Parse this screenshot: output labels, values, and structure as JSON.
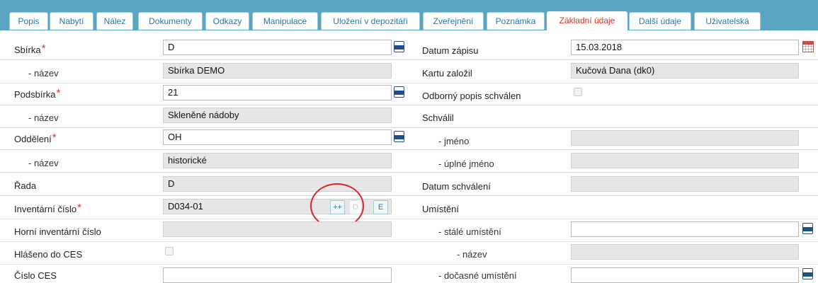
{
  "tabs": [
    {
      "label": "Popis"
    },
    {
      "label": "Nabytí"
    },
    {
      "label": "Nález"
    },
    {
      "label": "Dokumenty"
    },
    {
      "label": "Odkazy"
    },
    {
      "label": "Manipulace"
    },
    {
      "label": "Uložení v depozitáři"
    },
    {
      "label": "Zveřejnění"
    },
    {
      "label": "Poznámka"
    },
    {
      "label": "Základní údaje"
    },
    {
      "label": "Další údaje"
    },
    {
      "label": "Uživatelská"
    }
  ],
  "active_tab": "Základní údaje",
  "left": {
    "sbirka": {
      "label": "Sbírka",
      "value": "D"
    },
    "sbirka_nazev": {
      "label": "- název",
      "value": "Sbírka DEMO"
    },
    "podsbirka": {
      "label": "Podsbírka",
      "value": "21"
    },
    "podsbirka_nazev": {
      "label": "- název",
      "value": "Skleněné nádoby"
    },
    "oddeleni": {
      "label": "Oddělení",
      "value": "OH"
    },
    "oddeleni_nazev": {
      "label": "- název",
      "value": "historické"
    },
    "rada": {
      "label": "Řada",
      "value": "D"
    },
    "inventarni_cislo": {
      "label": "Inventární číslo",
      "value": "D034-01"
    },
    "inv_buttons": {
      "plus": "++",
      "disabled": "D",
      "edit": "E"
    },
    "horni_inventarni_cislo": {
      "label": "Horní inventární číslo",
      "value": ""
    },
    "hlaseno_ces": {
      "label": "Hlášeno do CES",
      "checked": false
    },
    "cislo_ces": {
      "label": "Číslo CES",
      "value": ""
    }
  },
  "right": {
    "datum_zapisu": {
      "label": "Datum zápisu",
      "value": "15.03.2018"
    },
    "kartu_zalozil": {
      "label": "Kartu založil",
      "value": "Kučová Dana (dk0)"
    },
    "odborny_popis": {
      "label": "Odborný popis schválen",
      "checked": false
    },
    "schvalil": {
      "label": "Schválil"
    },
    "jmeno": {
      "label": "- jméno",
      "value": ""
    },
    "uplne_jmeno": {
      "label": "- úplné jméno",
      "value": ""
    },
    "datum_schvaleni": {
      "label": "Datum schválení",
      "value": ""
    },
    "umisteni": {
      "label": "Umístění"
    },
    "stale_umisteni": {
      "label": "- stálé umístění",
      "value": ""
    },
    "stale_nazev": {
      "label": "- název",
      "value": ""
    },
    "docasne_umisteni": {
      "label": "- dočasné umístění",
      "value": ""
    }
  },
  "required_mark": "*",
  "annotation_color": "#d8242a"
}
